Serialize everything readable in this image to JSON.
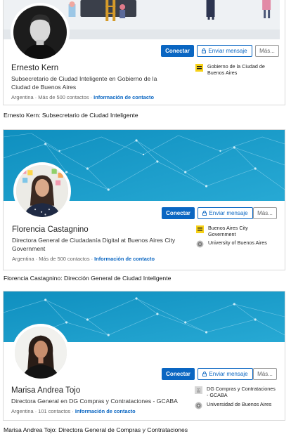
{
  "profiles": [
    {
      "name": "Ernesto Kern",
      "headline": "Subsecretario de Ciudad Inteligente en Gobierno de la Ciudad de Buenos Aires",
      "location": "Argentina",
      "connections": "Más de 500 contactos",
      "contact_info": "Información de contacto",
      "orgs": [
        {
          "label": "Gobierno de la Ciudad de Buenos Aires",
          "icon": "ba-city-logo-icon"
        }
      ],
      "caption": "Ernesto Kern: Subsecretario de Ciudad Inteligente"
    },
    {
      "name": "Florencia Castagnino",
      "headline": "Directora General de Ciudadanía Digital at Buenos Aires City Government",
      "location": "Argentina",
      "connections": "Más de 500 contactos",
      "contact_info": "Información de contacto",
      "orgs": [
        {
          "label": "Buenos Aires City Government",
          "icon": "ba-city-logo-icon"
        },
        {
          "label": "University of Buenos Aires",
          "icon": "university-logo-icon"
        }
      ],
      "caption": "Florencia Castagnino: Dirección General de Ciudad Inteligente"
    },
    {
      "name": "Marisa Andrea Tojo",
      "headline": "Directora General en DG Compras y Contrataciones - GCABA",
      "location": "Argentina",
      "connections": "101 contactos",
      "contact_info": "Información de contacto",
      "orgs": [
        {
          "label": "DG Compras y Contrataciones - GCABA",
          "icon": "company-placeholder-icon"
        },
        {
          "label": "Universidad de Buenos Aires",
          "icon": "university-logo-icon"
        }
      ],
      "caption": "Marisa Andrea Tojo: Directora General de Compras y Contrataciones"
    }
  ],
  "actions": {
    "connect": "Conectar",
    "message": "Enviar mensaje",
    "more": "Más..."
  },
  "meta_separator": "·",
  "colors": {
    "accent": "#0a66c2",
    "banner_teal": "#1a98c8",
    "ba_yellow": "#f7d117"
  }
}
